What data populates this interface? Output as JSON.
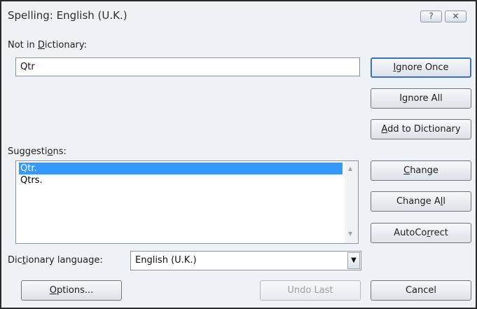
{
  "window": {
    "title": "Spelling: English (U.K.)",
    "help_glyph": "?",
    "close_glyph": "✕"
  },
  "not_in_dictionary": {
    "label_pre": "Not in ",
    "label_key": "D",
    "label_post": "ictionary:",
    "value": "Qtr"
  },
  "suggestions": {
    "label_pre": "Suggesti",
    "label_key": "o",
    "label_post": "ns:",
    "items": [
      {
        "text": "Qtr.",
        "selected": true
      },
      {
        "text": "Qtrs.",
        "selected": false
      }
    ]
  },
  "language": {
    "label_pre": "Dic",
    "label_key": "t",
    "label_post": "ionary language:",
    "value": "English (U.K.)"
  },
  "buttons": {
    "ignore_once": {
      "pre": "",
      "key": "I",
      "post": "gnore Once"
    },
    "ignore_all": {
      "pre": "I",
      "key": "g",
      "post": "nore All"
    },
    "add_to_dictionary": {
      "pre": "",
      "key": "A",
      "post": "dd to Dictionary"
    },
    "change": {
      "pre": "",
      "key": "C",
      "post": "hange"
    },
    "change_all": {
      "pre": "Change A",
      "key": "l",
      "post": "l"
    },
    "autocorrect": {
      "pre": "AutoCo",
      "key": "r",
      "post": "rect"
    },
    "options": {
      "pre": "",
      "key": "O",
      "post": "ptions..."
    },
    "undo_last": {
      "pre": "Undo Last",
      "key": "",
      "post": ""
    },
    "cancel": {
      "pre": "Cancel",
      "key": "",
      "post": ""
    }
  },
  "icons": {
    "scroll_up": "up-arrow",
    "scroll_down": "down-arrow",
    "dropdown": "dropdown-arrow"
  },
  "colors": {
    "selection": "#3399ff",
    "default_button_border": "#3d6fc6"
  }
}
